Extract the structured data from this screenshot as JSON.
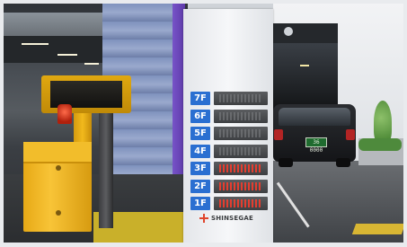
{
  "scene": {
    "type": "photo",
    "subject": "parking-garage-entrance"
  },
  "sign": {
    "floors": [
      {
        "label": "7F",
        "lit": false
      },
      {
        "label": "6F",
        "lit": false
      },
      {
        "label": "5F",
        "lit": false
      },
      {
        "label": "4F",
        "lit": false
      },
      {
        "label": "3F",
        "lit": true
      },
      {
        "label": "2F",
        "lit": true
      },
      {
        "label": "1F",
        "lit": true
      }
    ],
    "brand_name": "SHINSEGAE",
    "badge_color": "#2a6fd1",
    "lit_color": "#ff3b2a"
  },
  "car": {
    "plate": "36 0000"
  },
  "colors": {
    "barrier": "#f2bd2b",
    "wall": "#8c9dc6",
    "trim": "#6a45b8"
  }
}
